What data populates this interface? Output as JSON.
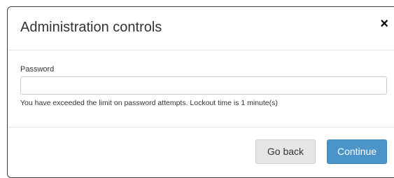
{
  "dialog": {
    "title": "Administration controls",
    "close_glyph": "×",
    "close_icon": "close-icon"
  },
  "form": {
    "password_label": "Password",
    "password_value": "",
    "password_placeholder": "",
    "help_text": "You have exceeded the limit on password attempts. Lockout time is 1 minute(s)"
  },
  "footer": {
    "back_label": "Go back",
    "continue_label": "Continue"
  },
  "colors": {
    "primary": "#4a94c9",
    "secondary": "#e6e6e6",
    "border": "#3a3a3a"
  }
}
